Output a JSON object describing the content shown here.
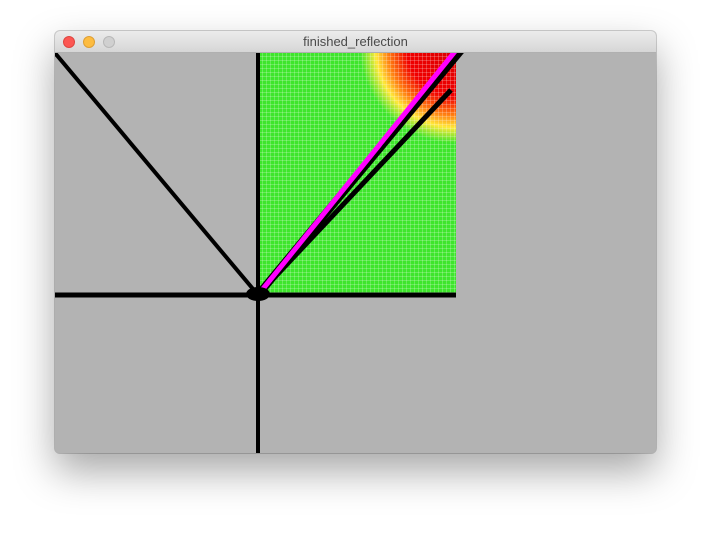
{
  "window": {
    "title": "finished_reflection"
  },
  "colors": {
    "background": "#b3b3b3",
    "field": "#3ee52c",
    "highlight_hot": "#f00000",
    "highlight_warm": "#ffe83a",
    "axis": "#000000",
    "reflected_ray": "#ff00ff"
  },
  "icons": {
    "close": "traffic-light-close-icon",
    "minimize": "traffic-light-minimize-icon",
    "zoom": "traffic-light-zoom-icon"
  }
}
